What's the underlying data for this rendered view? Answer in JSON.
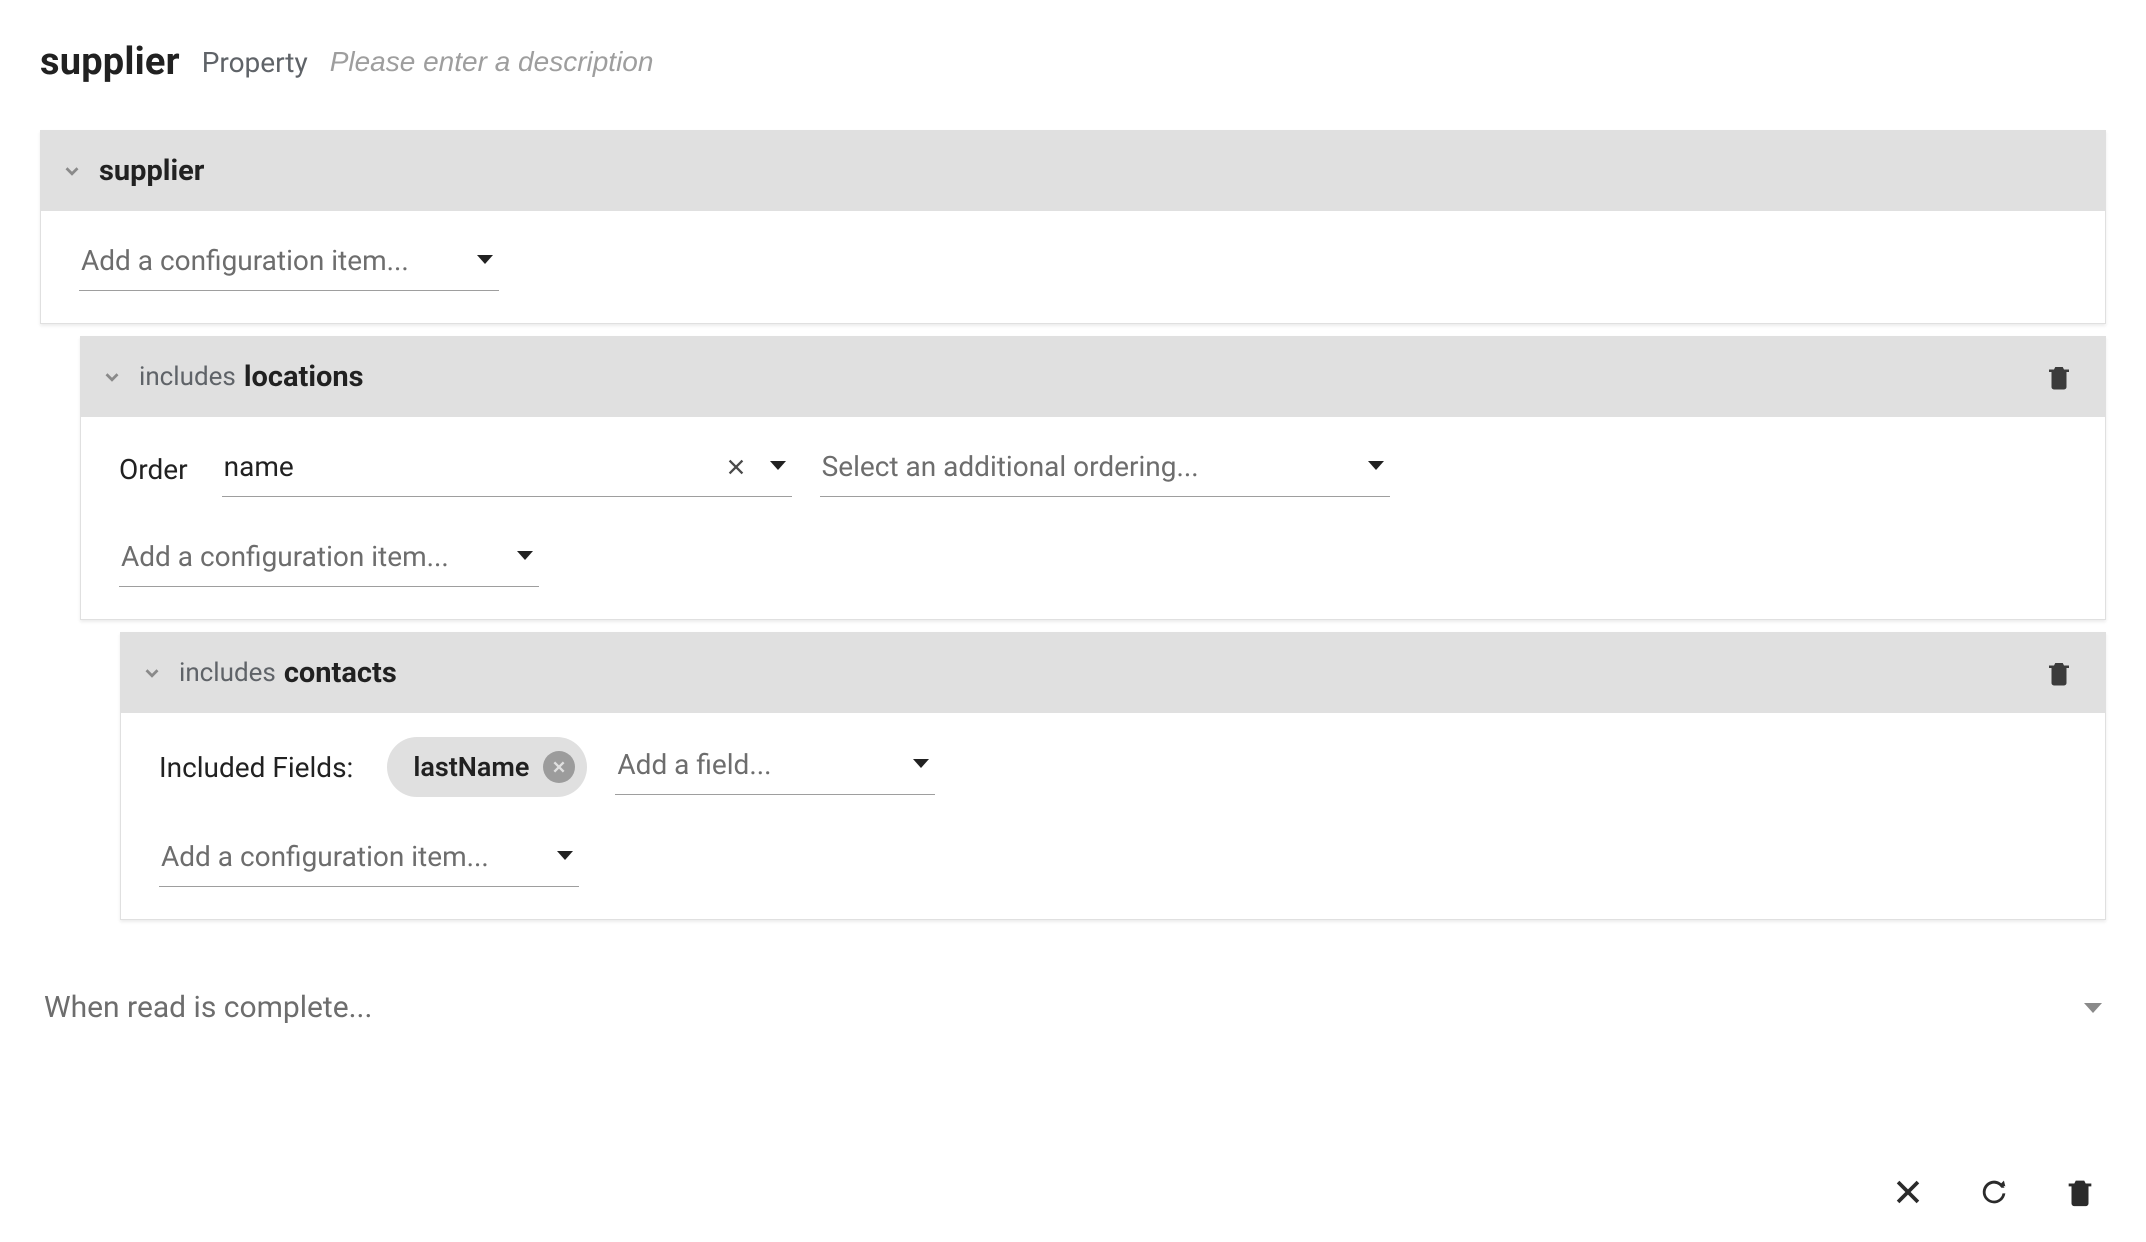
{
  "header": {
    "title": "supplier",
    "subtitle": "Property",
    "description_placeholder": "Please enter a description"
  },
  "panels": {
    "root": {
      "entity": "supplier",
      "config_placeholder": "Add a configuration item..."
    },
    "locations": {
      "includes_label": "includes",
      "entity": "locations",
      "order_label": "Order",
      "order_value": "name",
      "order2_placeholder": "Select an additional ordering...",
      "config_placeholder": "Add a configuration item..."
    },
    "contacts": {
      "includes_label": "includes",
      "entity": "contacts",
      "included_fields_label": "Included Fields:",
      "chip_label": "lastName",
      "add_field_placeholder": "Add a field...",
      "config_placeholder": "Add a configuration item..."
    }
  },
  "footer": {
    "label": "When read is complete..."
  }
}
